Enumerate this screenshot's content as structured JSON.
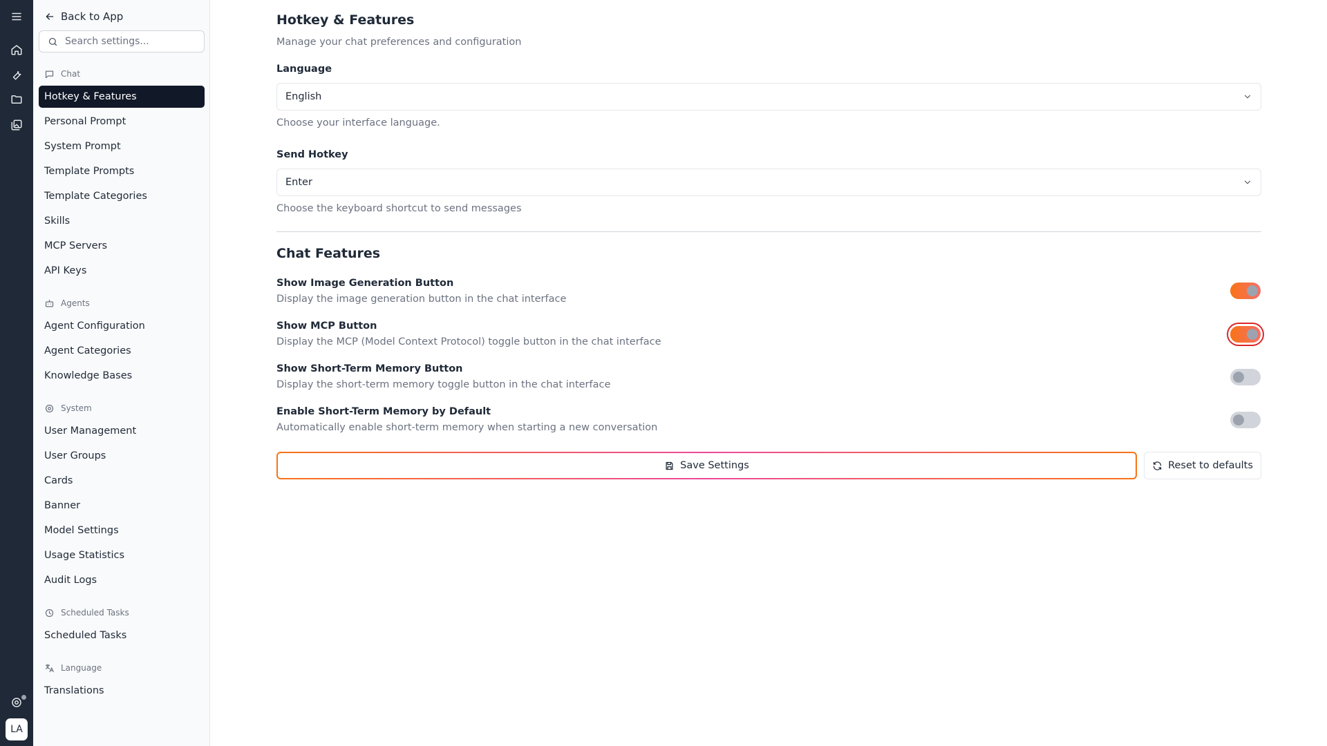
{
  "rail": {
    "icons": [
      "menu-icon",
      "home-icon",
      "wrench-icon",
      "folder-icon",
      "gallery-icon",
      "support-icon"
    ],
    "avatar_initials": "LA"
  },
  "sidebar": {
    "back_label": "Back to App",
    "search_placeholder": "Search settings...",
    "groups": {
      "chat": "Chat",
      "agents": "Agents",
      "system": "System",
      "scheduled": "Scheduled Tasks",
      "language": "Language"
    },
    "items": {
      "hotkey_features": "Hotkey & Features",
      "personal_prompt": "Personal Prompt",
      "system_prompt": "System Prompt",
      "template_prompts": "Template Prompts",
      "template_categories": "Template Categories",
      "skills": "Skills",
      "mcp_servers": "MCP Servers",
      "api_keys": "API Keys",
      "agent_configuration": "Agent Configuration",
      "agent_categories": "Agent Categories",
      "knowledge_bases": "Knowledge Bases",
      "user_management": "User Management",
      "user_groups": "User Groups",
      "cards": "Cards",
      "banner": "Banner",
      "model_settings": "Model Settings",
      "usage_statistics": "Usage Statistics",
      "audit_logs": "Audit Logs",
      "scheduled_tasks": "Scheduled Tasks",
      "translations": "Translations"
    },
    "active_item": "Hotkey & Features"
  },
  "main": {
    "title": "Hotkey & Features",
    "subtitle": "Manage your chat preferences and configuration",
    "language": {
      "label": "Language",
      "value": "English",
      "help": "Choose your interface language."
    },
    "send_hotkey": {
      "label": "Send Hotkey",
      "value": "Enter",
      "help": "Choose the keyboard shortcut to send messages"
    },
    "features_title": "Chat Features",
    "features": [
      {
        "title": "Show Image Generation Button",
        "desc": "Display the image generation button in the chat interface",
        "enabled": true
      },
      {
        "title": "Show MCP Button",
        "desc": "Display the MCP (Model Context Protocol) toggle button in the chat interface",
        "enabled": true
      },
      {
        "title": "Show Short-Term Memory Button",
        "desc": "Display the short-term memory toggle button in the chat interface",
        "enabled": false
      },
      {
        "title": "Enable Short-Term Memory by Default",
        "desc": "Automatically enable short-term memory when starting a new conversation",
        "enabled": false
      }
    ],
    "save_label": "Save Settings",
    "reset_label": "Reset to defaults"
  },
  "colors": {
    "rail_bg": "#1f2937",
    "active_nav_bg": "#111827",
    "toggle_on": "#f97316",
    "toggle_off": "#d1d5db",
    "focus_ring": "#dc2626"
  }
}
